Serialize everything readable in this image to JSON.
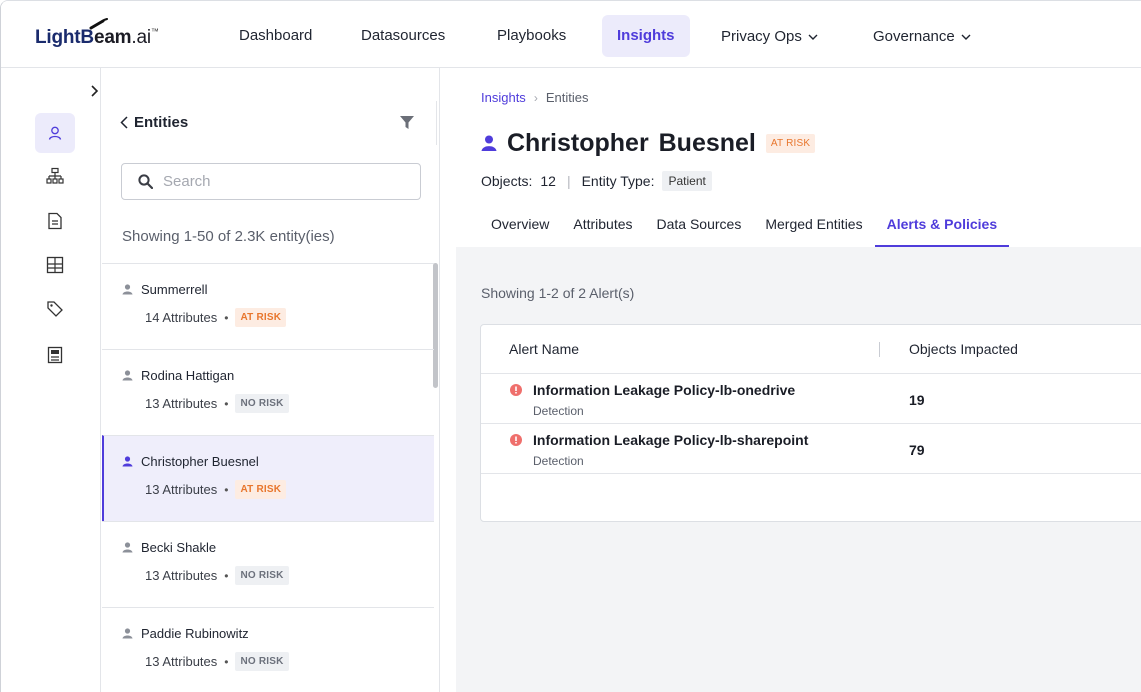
{
  "brand": {
    "name_part1": "LightB",
    "name_part2": "eam",
    "name_part3": ".ai",
    "trademark": "™",
    "accent": "#4f3cdb"
  },
  "nav": {
    "items": [
      {
        "label": "Dashboard"
      },
      {
        "label": "Datasources"
      },
      {
        "label": "Playbooks"
      },
      {
        "label": "Insights",
        "active": true
      },
      {
        "label": "Privacy Ops"
      },
      {
        "label": "Governance"
      }
    ]
  },
  "rail": {
    "icons": [
      "user-icon",
      "hierarchy-icon",
      "document-icon",
      "table-icon",
      "tag-icon",
      "report-icon"
    ]
  },
  "entities": {
    "back_label": "Entities",
    "search_placeholder": "Search",
    "showing": "Showing 1-50 of 2.3K entity(ies)",
    "items": [
      {
        "name": "Summerrell",
        "attributes": "14 Attributes",
        "risk": "AT RISK"
      },
      {
        "name": "Rodina Hattigan",
        "attributes": "13 Attributes",
        "risk": "NO RISK"
      },
      {
        "name": "Christopher Buesnel",
        "attributes": "13 Attributes",
        "risk": "AT RISK"
      },
      {
        "name": "Becki Shakle",
        "attributes": "13 Attributes",
        "risk": "NO RISK"
      },
      {
        "name": "Paddie Rubinowitz",
        "attributes": "13 Attributes",
        "risk": "NO RISK"
      }
    ]
  },
  "detail": {
    "breadcrumb": {
      "parent": "Insights",
      "current": "Entities"
    },
    "name": "Christopher  Buesnel",
    "risk": "AT RISK",
    "objects_label": "Objects:",
    "objects_value": "12",
    "entity_type_label": "Entity Type:",
    "entity_type_value": "Patient",
    "tabs": [
      "Overview",
      "Attributes",
      "Data Sources",
      "Merged Entities",
      "Alerts & Policies"
    ],
    "alerts_count": "Showing 1-2 of 2 Alert(s)",
    "table": {
      "col_alert": "Alert Name",
      "col_objects": "Objects Impacted",
      "rows": [
        {
          "name": "Information Leakage Policy-lb-onedrive",
          "type": "Detection",
          "objects": "19"
        },
        {
          "name": "Information Leakage Policy-lb-sharepoint",
          "type": "Detection",
          "objects": "79"
        }
      ]
    }
  }
}
